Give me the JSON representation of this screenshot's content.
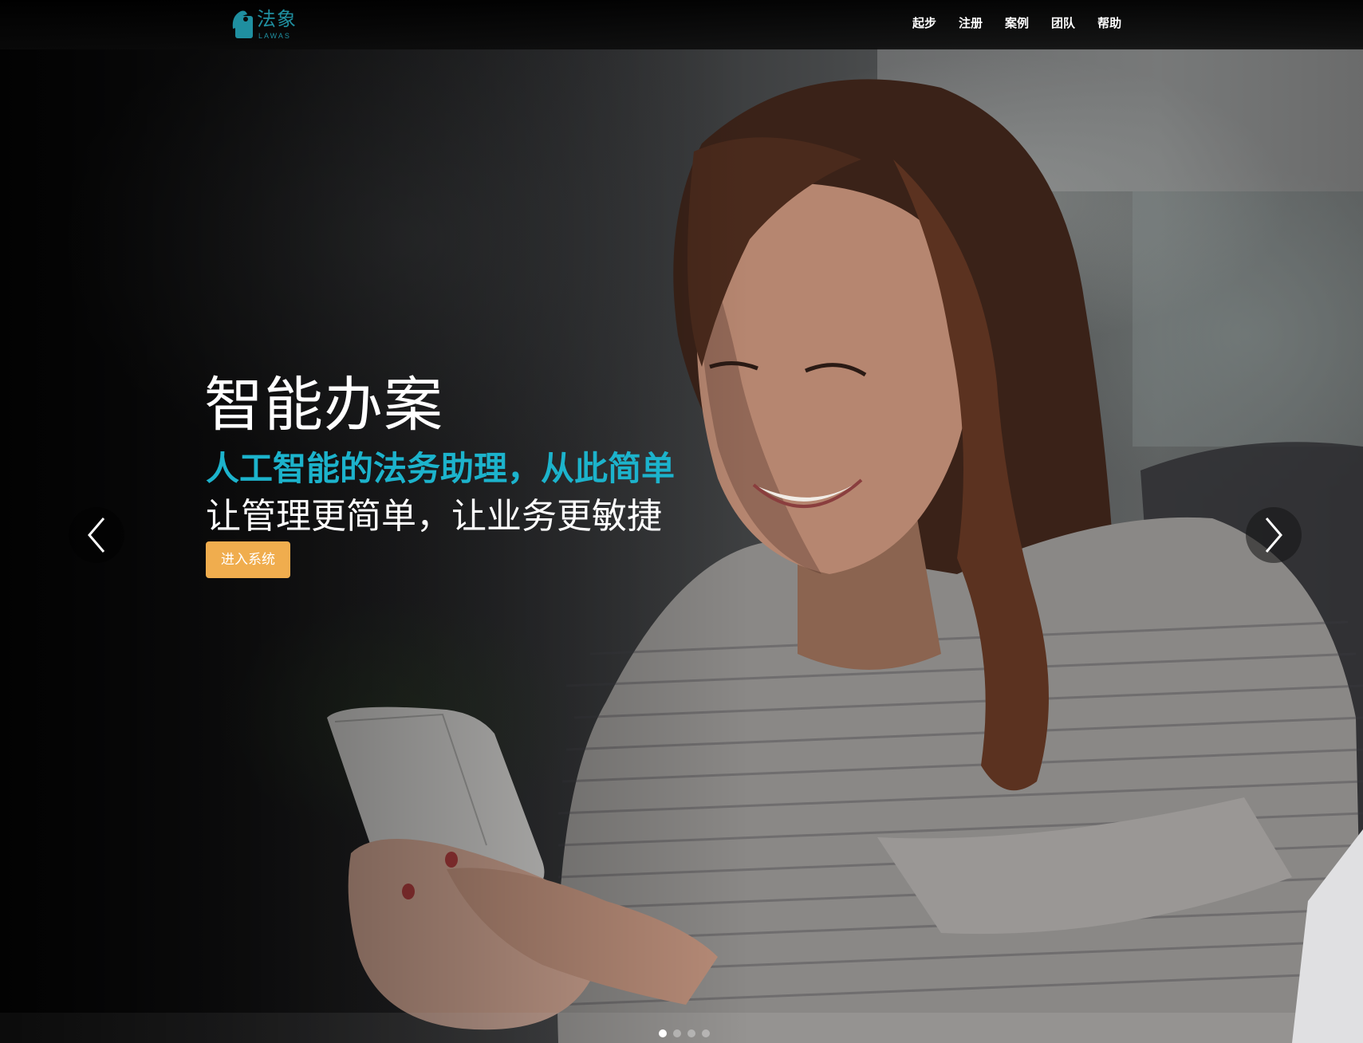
{
  "logo": {
    "name_cn": "法象",
    "name_en": "LAWAS",
    "color": "#1f8fa0"
  },
  "nav": {
    "items": [
      {
        "label": "起步"
      },
      {
        "label": "注册"
      },
      {
        "label": "案例"
      },
      {
        "label": "团队"
      },
      {
        "label": "帮助"
      }
    ]
  },
  "hero": {
    "title": "智能办案",
    "subtitle": "人工智能的法务助理，从此简单",
    "tagline": "让管理更简单，让业务更敏捷",
    "cta_label": "进入系统",
    "accent_color": "#1cb3cc",
    "cta_color": "#f0ad4e"
  },
  "carousel": {
    "prev_icon": "chevron-left-icon",
    "next_icon": "chevron-right-icon",
    "slide_count": 4,
    "active_index": 0
  }
}
